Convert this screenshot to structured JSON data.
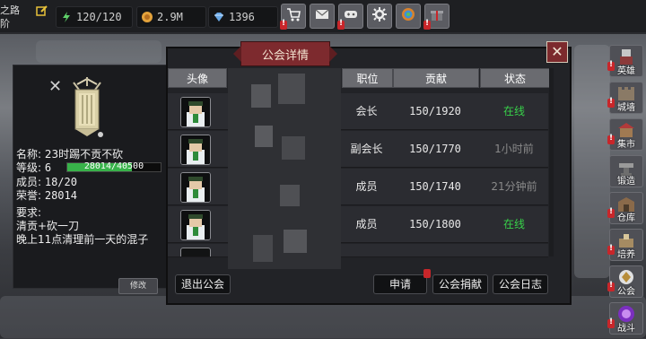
{
  "colors": {
    "online": "#38d24a",
    "offline": "#8a8a8a",
    "accent": "#7d2a2e",
    "xp": "#38b24a"
  },
  "topbar": {
    "left_label_line1": "之路",
    "left_label_line2": "阶",
    "stamina": "120/120",
    "gold": "2.9M",
    "gems": "1396",
    "buttons": [
      {
        "name": "shop-cart-icon"
      },
      {
        "name": "mail-icon"
      },
      {
        "name": "gamepad-icon"
      },
      {
        "name": "settings-gear-icon"
      },
      {
        "name": "swirl-icon"
      },
      {
        "name": "gift-icon"
      }
    ]
  },
  "sidenav": {
    "items": [
      {
        "label": "英雄",
        "icon": "hero-icon",
        "badge": true
      },
      {
        "label": "城墙",
        "icon": "castle-wall-icon",
        "badge": true
      },
      {
        "label": "集市",
        "icon": "market-icon",
        "badge": true
      },
      {
        "label": "锻造",
        "icon": "anvil-icon",
        "badge": false
      },
      {
        "label": "仓库",
        "icon": "warehouse-icon",
        "badge": true
      },
      {
        "label": "培养",
        "icon": "training-icon",
        "badge": true
      },
      {
        "label": "公会",
        "icon": "guild-icon",
        "badge": true
      },
      {
        "label": "战斗",
        "icon": "battle-portal-icon",
        "badge": true
      }
    ]
  },
  "guild_info": {
    "name_label": "名称: 23时踢不贡不砍",
    "level_label": "等级: ",
    "level_value": "6",
    "xp_text": "28014/40500",
    "xp_fraction": 0.692,
    "members_label": "成员: ",
    "members_value": "18/20",
    "honor_label": "荣誉: ",
    "honor_value": "28014",
    "requirement_title": "要求:",
    "requirement_line1": "清贡+砍一刀",
    "requirement_line2": "晚上11点清理前一天的混子",
    "edit_button": "修改"
  },
  "dialog": {
    "title": "公会详情",
    "columns": {
      "avatar": "头像",
      "position": "职位",
      "contribution": "贡献",
      "status": "状态"
    },
    "members": [
      {
        "position": "会长",
        "contribution": "150/1920",
        "status": "在线",
        "online": true
      },
      {
        "position": "副会长",
        "contribution": "150/1770",
        "status": "1小时前",
        "online": false
      },
      {
        "position": "成员",
        "contribution": "150/1740",
        "status": "21分钟前",
        "online": false
      },
      {
        "position": "成员",
        "contribution": "150/1800",
        "status": "在线",
        "online": true
      }
    ],
    "footer": {
      "leave": "退出公会",
      "apply": "申请",
      "donate": "公会捐献",
      "log": "公会日志"
    }
  }
}
